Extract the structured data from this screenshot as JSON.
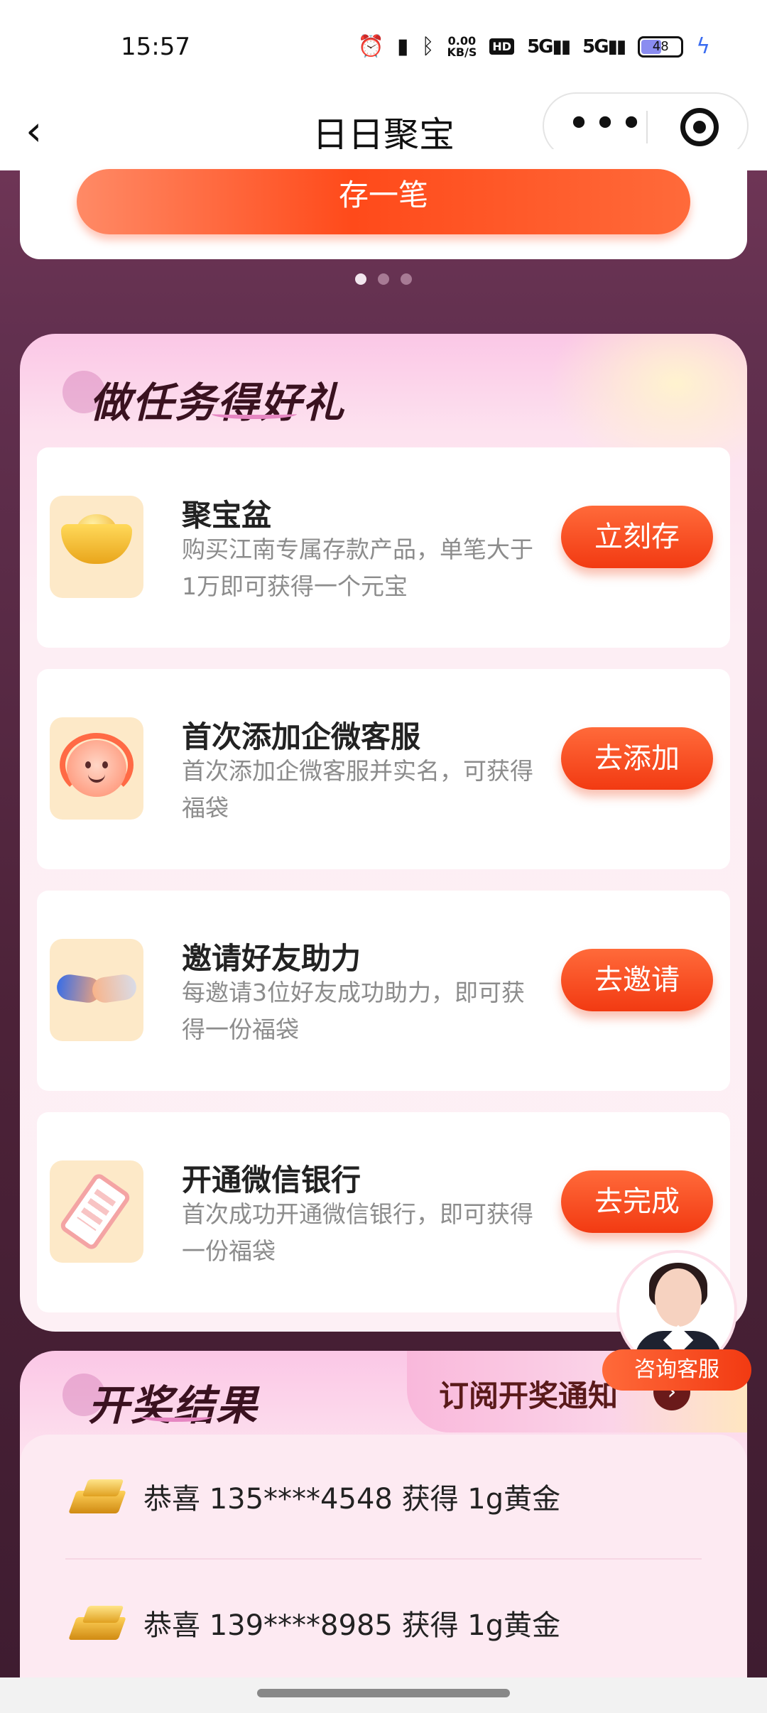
{
  "status_bar": {
    "time": "15:57",
    "net_speed": "0.00",
    "net_unit": "KB/S",
    "hd_label": "HD",
    "signal1": "5G",
    "signal2": "5G",
    "battery": "48"
  },
  "nav": {
    "title": "日日聚宝",
    "more_label": "•••"
  },
  "top_card": {
    "deposit_label": "存一笔"
  },
  "carousel": {
    "dots": 3,
    "active_index": 0
  },
  "tasks_section": {
    "title": "做任务得好礼",
    "items": [
      {
        "name": "聚宝盆",
        "desc": "购买江南专属存款产品，单笔大于1万即可获得一个元宝",
        "button": "立刻存",
        "icon": "gold-ingot-icon"
      },
      {
        "name": "首次添加企微客服",
        "desc": "首次添加企微客服并实名，可获得福袋",
        "button": "去添加",
        "icon": "customer-service-icon"
      },
      {
        "name": "邀请好友助力",
        "desc": "每邀请3位好友成功助力，即可获得一份福袋",
        "button": "去邀请",
        "icon": "handshake-icon"
      },
      {
        "name": "开通微信银行",
        "desc": "首次成功开通微信银行，即可获得一份福袋",
        "button": "去完成",
        "icon": "phone-icon"
      }
    ]
  },
  "lottery_section": {
    "title": "开奖结果",
    "subscribe_label": "订阅开奖通知",
    "winners": [
      {
        "text": "恭喜 135****4548 获得 1g黄金"
      },
      {
        "text": "恭喜 139****8985 获得 1g黄金"
      }
    ]
  },
  "service": {
    "label": "咨询客服"
  },
  "colors": {
    "accent": "#f23a12",
    "panel_bg": "#fdeef4",
    "page_bg": "#5a2a44"
  }
}
